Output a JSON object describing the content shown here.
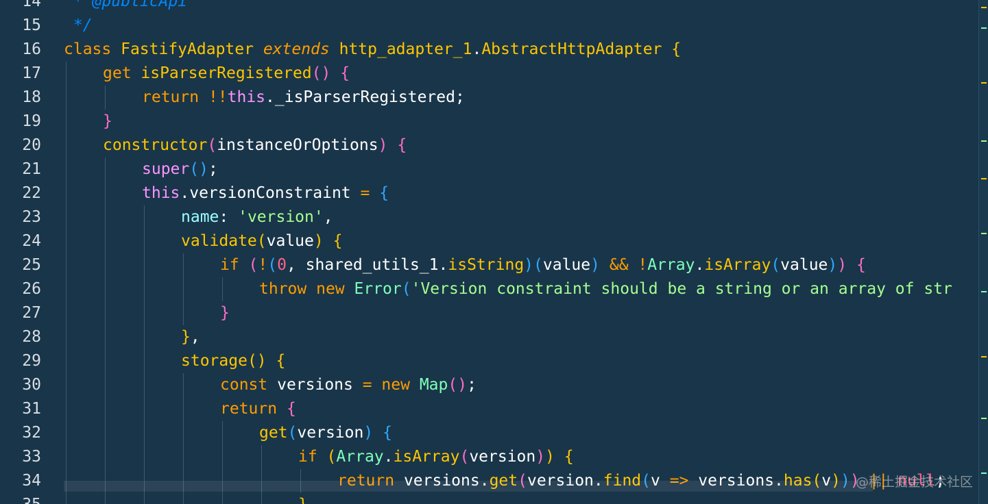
{
  "watermark": "@稀土掘金技术社区",
  "lines": [
    {
      "n": "14",
      "indent": 0,
      "tokens": [
        {
          "t": " * @publicApi",
          "c": "cmt"
        }
      ]
    },
    {
      "n": "15",
      "indent": 0,
      "tokens": [
        {
          "t": " */",
          "c": "cmt"
        }
      ]
    },
    {
      "n": "16",
      "indent": 0,
      "tokens": [
        {
          "t": "class ",
          "c": "kw"
        },
        {
          "t": "FastifyAdapter ",
          "c": "ty"
        },
        {
          "t": "extends ",
          "c": "ital"
        },
        {
          "t": "http_adapter_1",
          "c": "ty"
        },
        {
          "t": ".",
          "c": "plain"
        },
        {
          "t": "AbstractHttpAdapter ",
          "c": "ty"
        },
        {
          "t": "{",
          "c": "b1"
        }
      ]
    },
    {
      "n": "17",
      "indent": 1,
      "tokens": [
        {
          "t": "get ",
          "c": "kw"
        },
        {
          "t": "isParserRegistered",
          "c": "fn"
        },
        {
          "t": "()",
          "c": "b2"
        },
        {
          "t": " ",
          "c": "plain"
        },
        {
          "t": "{",
          "c": "b2"
        }
      ]
    },
    {
      "n": "18",
      "indent": 2,
      "tokens": [
        {
          "t": "return ",
          "c": "kw"
        },
        {
          "t": "!!",
          "c": "op"
        },
        {
          "t": "this",
          "c": "this"
        },
        {
          "t": "._isParserRegistered;",
          "c": "plain"
        }
      ]
    },
    {
      "n": "19",
      "indent": 1,
      "tokens": [
        {
          "t": "}",
          "c": "b2"
        }
      ]
    },
    {
      "n": "20",
      "indent": 1,
      "tokens": [
        {
          "t": "constructor",
          "c": "fn"
        },
        {
          "t": "(",
          "c": "b2"
        },
        {
          "t": "instanceOrOptions",
          "c": "plain"
        },
        {
          "t": ")",
          "c": "b2"
        },
        {
          "t": " ",
          "c": "plain"
        },
        {
          "t": "{",
          "c": "b2"
        }
      ]
    },
    {
      "n": "21",
      "indent": 2,
      "tokens": [
        {
          "t": "super",
          "c": "this"
        },
        {
          "t": "()",
          "c": "b3"
        },
        {
          "t": ";",
          "c": "plain"
        }
      ]
    },
    {
      "n": "22",
      "indent": 2,
      "tokens": [
        {
          "t": "this",
          "c": "this"
        },
        {
          "t": ".versionConstraint ",
          "c": "plain"
        },
        {
          "t": "= ",
          "c": "eq"
        },
        {
          "t": "{",
          "c": "b3"
        }
      ]
    },
    {
      "n": "23",
      "indent": 3,
      "tokens": [
        {
          "t": "name",
          "c": "prop"
        },
        {
          "t": ": ",
          "c": "plain"
        },
        {
          "t": "'version'",
          "c": "str"
        },
        {
          "t": ",",
          "c": "plain"
        }
      ]
    },
    {
      "n": "24",
      "indent": 3,
      "tokens": [
        {
          "t": "validate",
          "c": "fn"
        },
        {
          "t": "(",
          "c": "b1"
        },
        {
          "t": "value",
          "c": "plain"
        },
        {
          "t": ")",
          "c": "b1"
        },
        {
          "t": " ",
          "c": "plain"
        },
        {
          "t": "{",
          "c": "b1"
        }
      ]
    },
    {
      "n": "25",
      "indent": 4,
      "tokens": [
        {
          "t": "if ",
          "c": "kw"
        },
        {
          "t": "(",
          "c": "b2"
        },
        {
          "t": "!",
          "c": "op"
        },
        {
          "t": "(",
          "c": "b3"
        },
        {
          "t": "0",
          "c": "num"
        },
        {
          "t": ", shared_utils_1.",
          "c": "plain"
        },
        {
          "t": "isString",
          "c": "fn"
        },
        {
          "t": ")",
          "c": "b3"
        },
        {
          "t": "(",
          "c": "b3"
        },
        {
          "t": "value",
          "c": "plain"
        },
        {
          "t": ")",
          "c": "b3"
        },
        {
          "t": " && ",
          "c": "op"
        },
        {
          "t": "!",
          "c": "op"
        },
        {
          "t": "Array",
          "c": "cls"
        },
        {
          "t": ".",
          "c": "plain"
        },
        {
          "t": "isArray",
          "c": "fn"
        },
        {
          "t": "(",
          "c": "b3"
        },
        {
          "t": "value",
          "c": "plain"
        },
        {
          "t": ")",
          "c": "b3"
        },
        {
          "t": ")",
          "c": "b2"
        },
        {
          "t": " ",
          "c": "plain"
        },
        {
          "t": "{",
          "c": "b2"
        }
      ]
    },
    {
      "n": "26",
      "indent": 5,
      "tokens": [
        {
          "t": "throw ",
          "c": "kw"
        },
        {
          "t": "new ",
          "c": "kw"
        },
        {
          "t": "Error",
          "c": "cls"
        },
        {
          "t": "(",
          "c": "b3"
        },
        {
          "t": "'Version constraint should be a string or an array of str",
          "c": "str"
        }
      ]
    },
    {
      "n": "27",
      "indent": 4,
      "tokens": [
        {
          "t": "}",
          "c": "b2"
        }
      ]
    },
    {
      "n": "28",
      "indent": 3,
      "tokens": [
        {
          "t": "}",
          "c": "b1"
        },
        {
          "t": ",",
          "c": "plain"
        }
      ]
    },
    {
      "n": "29",
      "indent": 3,
      "tokens": [
        {
          "t": "storage",
          "c": "fn"
        },
        {
          "t": "()",
          "c": "b1"
        },
        {
          "t": " ",
          "c": "plain"
        },
        {
          "t": "{",
          "c": "b1"
        }
      ]
    },
    {
      "n": "30",
      "indent": 4,
      "tokens": [
        {
          "t": "const ",
          "c": "kw"
        },
        {
          "t": "versions ",
          "c": "plain"
        },
        {
          "t": "= ",
          "c": "eq"
        },
        {
          "t": "new ",
          "c": "kw"
        },
        {
          "t": "Map",
          "c": "cls"
        },
        {
          "t": "()",
          "c": "b2"
        },
        {
          "t": ";",
          "c": "plain"
        }
      ]
    },
    {
      "n": "31",
      "indent": 4,
      "tokens": [
        {
          "t": "return ",
          "c": "kw"
        },
        {
          "t": "{",
          "c": "b2"
        }
      ]
    },
    {
      "n": "32",
      "indent": 5,
      "tokens": [
        {
          "t": "get",
          "c": "fn"
        },
        {
          "t": "(",
          "c": "b3"
        },
        {
          "t": "version",
          "c": "plain"
        },
        {
          "t": ")",
          "c": "b3"
        },
        {
          "t": " ",
          "c": "plain"
        },
        {
          "t": "{",
          "c": "b3"
        }
      ]
    },
    {
      "n": "33",
      "indent": 6,
      "tokens": [
        {
          "t": "if ",
          "c": "kw"
        },
        {
          "t": "(",
          "c": "b1"
        },
        {
          "t": "Array",
          "c": "cls"
        },
        {
          "t": ".",
          "c": "plain"
        },
        {
          "t": "isArray",
          "c": "fn"
        },
        {
          "t": "(",
          "c": "b2"
        },
        {
          "t": "version",
          "c": "plain"
        },
        {
          "t": ")",
          "c": "b2"
        },
        {
          "t": ")",
          "c": "b1"
        },
        {
          "t": " ",
          "c": "plain"
        },
        {
          "t": "{",
          "c": "b1"
        }
      ]
    },
    {
      "n": "34",
      "indent": 7,
      "tokens": [
        {
          "t": "return ",
          "c": "kw"
        },
        {
          "t": "versions.",
          "c": "plain"
        },
        {
          "t": "get",
          "c": "fn"
        },
        {
          "t": "(",
          "c": "b2"
        },
        {
          "t": "version.",
          "c": "plain"
        },
        {
          "t": "find",
          "c": "fn"
        },
        {
          "t": "(",
          "c": "b3"
        },
        {
          "t": "v ",
          "c": "plain"
        },
        {
          "t": "=> ",
          "c": "op"
        },
        {
          "t": "versions.",
          "c": "plain"
        },
        {
          "t": "has",
          "c": "fn"
        },
        {
          "t": "(",
          "c": "b1"
        },
        {
          "t": "v",
          "c": "plain"
        },
        {
          "t": ")",
          "c": "b1"
        },
        {
          "t": ")",
          "c": "b3"
        },
        {
          "t": ")",
          "c": "b2"
        },
        {
          "t": " || ",
          "c": "op"
        },
        {
          "t": "null",
          "c": "nul"
        },
        {
          "t": ";",
          "c": "plain"
        }
      ]
    },
    {
      "n": "35",
      "indent": 6,
      "tokens": [
        {
          "t": "}",
          "c": "b1"
        }
      ]
    }
  ]
}
